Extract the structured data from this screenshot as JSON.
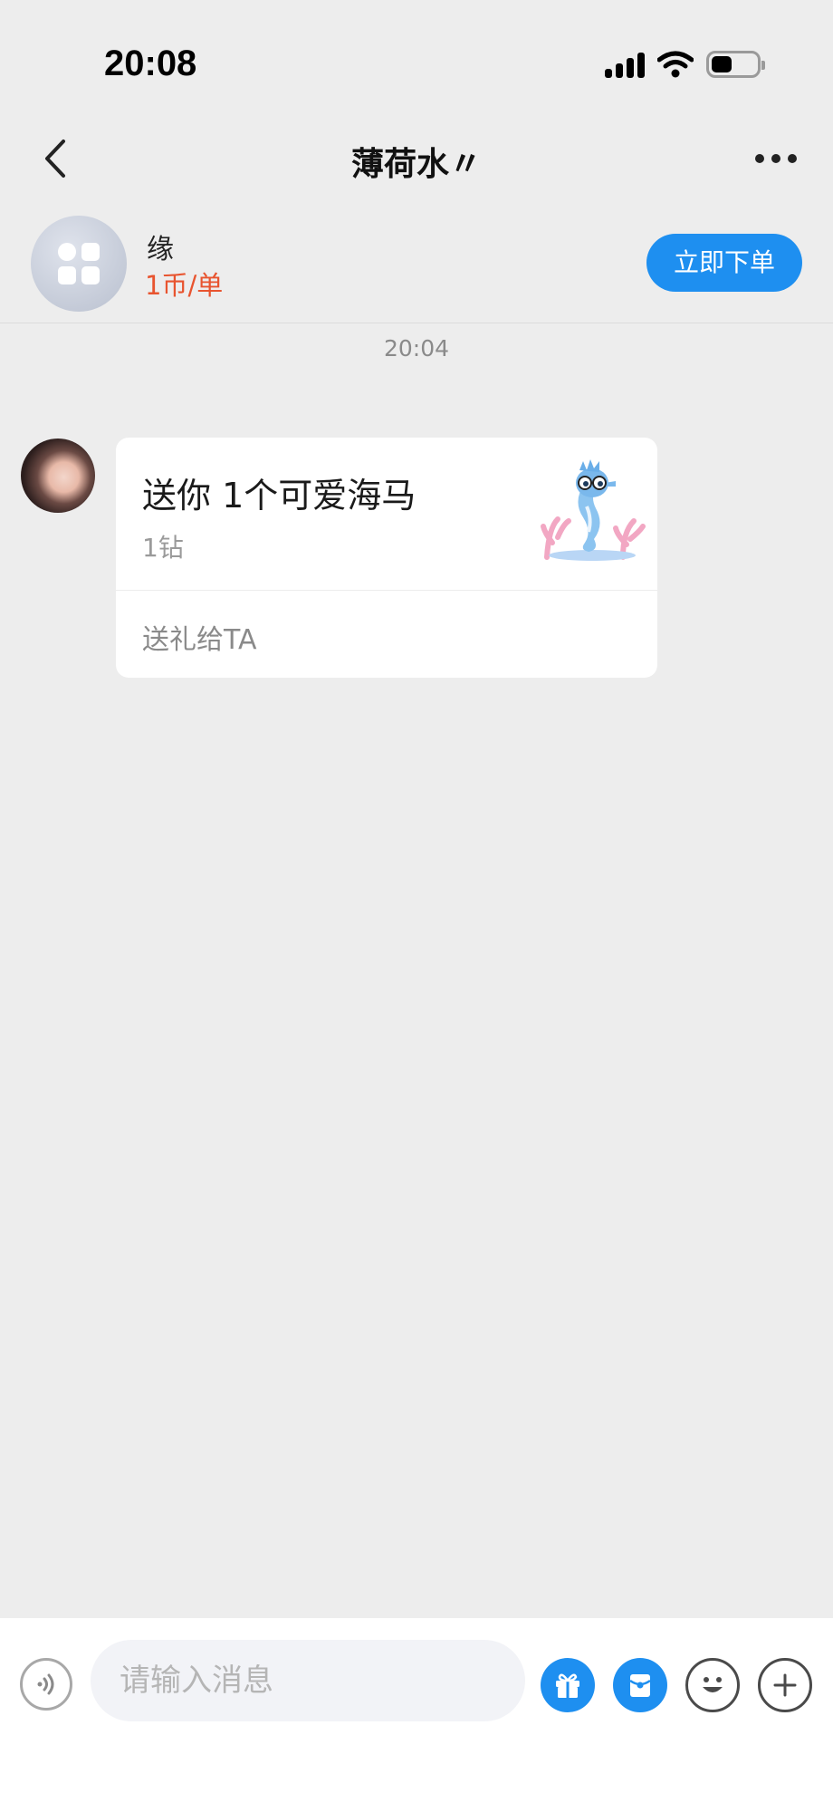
{
  "status_bar": {
    "time": "20:08",
    "battery_level": 0.45,
    "icons": [
      "cellular-signal-icon",
      "wifi-icon",
      "battery-icon"
    ]
  },
  "nav": {
    "back_icon": "chevron-left-icon",
    "title": "薄荷水〃",
    "more_icon": "more-horizontal-icon"
  },
  "service": {
    "name": "缘",
    "price": "1币/单",
    "order_button": "立即下单",
    "price_color": "#e8542f"
  },
  "chat": {
    "timestamp": "20:04",
    "gift_message": {
      "title": "送你 1个可爱海马",
      "price": "1钻",
      "action": "送礼给TA",
      "image_icon": "seahorse-gift-icon"
    }
  },
  "input_bar": {
    "placeholder": "请输入消息",
    "buttons": [
      "voice-icon",
      "gift-icon",
      "red-packet-icon",
      "emoji-icon",
      "plus-icon"
    ]
  },
  "colors": {
    "accent": "#1e8ff0",
    "background": "#ededed"
  }
}
